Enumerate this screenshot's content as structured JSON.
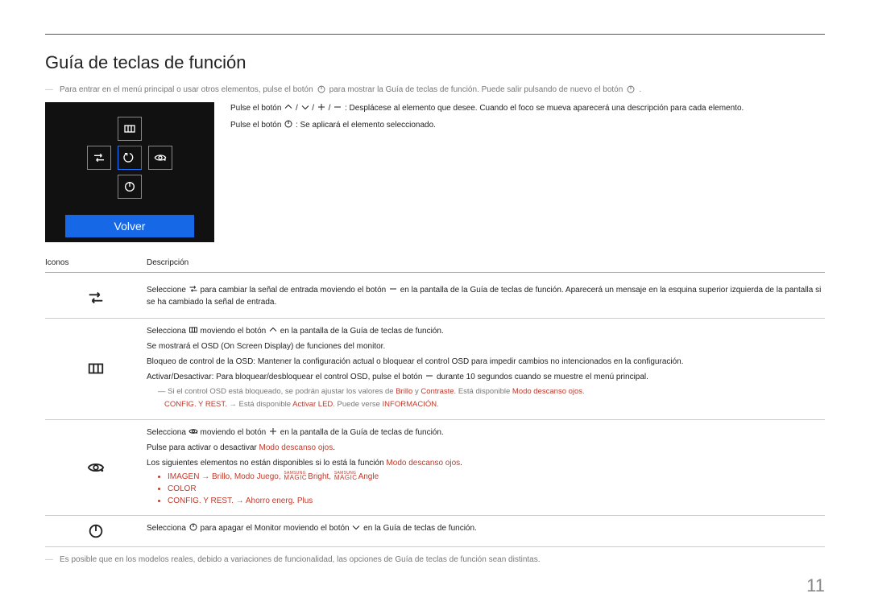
{
  "title": "Guía de teclas de función",
  "intro_note_a": "Para entrar en el menú principal o usar otros elementos, pulse el botón",
  "intro_note_b": "para mostrar la Guía de teclas de función. Puede salir pulsando de nuevo el botón",
  "osd_return": "Volver",
  "side_line1_a": "Pulse el botón",
  "side_line1_b": ": Desplácese al elemento que desee. Cuando el foco se mueva aparecerá una descripción para cada elemento.",
  "side_line2_a": "Pulse el botón",
  "side_line2_b": ": Se aplicará el elemento seleccionado.",
  "table": {
    "header_icon": "Iconos",
    "header_desc": "Descripción",
    "row1_a": "Seleccione",
    "row1_b": "para cambiar la señal de entrada moviendo el botón",
    "row1_c": "en la pantalla de la Guía de teclas de función. Aparecerá un mensaje en la esquina superior izquierda de la pantalla si se ha cambiado la señal de entrada.",
    "row2_a": "Selecciona",
    "row2_b": "moviendo el botón",
    "row2_c": "en la pantalla de la Guía de teclas de función.",
    "row2_d": "Se mostrará el OSD (On Screen Display) de funciones del monitor.",
    "row2_e": "Bloqueo de control de la OSD: Mantener la configuración actual o bloquear el control OSD para impedir cambios no intencionados en la configuración.",
    "row2_f": "Activar/Desactivar: Para bloquear/desbloquear el control OSD, pulse el botón",
    "row2_g": "durante 10 segundos cuando se muestre el menú principal.",
    "row2_note_a": "Si el control OSD está bloqueado, se podrán ajustar los valores de",
    "row2_note_brillo": "Brillo",
    "row2_note_y": " y ",
    "row2_note_contraste": "Contraste",
    "row2_note_mid": ". Está disponible ",
    "row2_note_modo": "Modo descanso ojos",
    "row2_note_period": ".",
    "row2_note2_a": "CONFIG. Y REST.",
    "row2_note2_b": " → Está disponible ",
    "row2_note2_c": "Activar LED",
    "row2_note2_d": ". Puede verse ",
    "row2_note2_e": "INFORMACIÓN",
    "row3_a": "Selecciona",
    "row3_b": "moviendo el botón",
    "row3_c": "en la pantalla de la Guía de teclas de función.",
    "row3_d_a": "Pulse para activar o desactivar ",
    "row3_d_b": "Modo descanso ojos",
    "row3_e_a": "Los siguientes elementos no están disponibles si lo está la función ",
    "row3_e_b": "Modo descanso ojos",
    "row3_bul1_a": "IMAGEN",
    "row3_bul1_b": "Brillo",
    "row3_bul1_c": "Modo Juego",
    "row3_bul1_bright": "Bright",
    "row3_bul1_angle": "Angle",
    "row3_bul2": "COLOR",
    "row3_bul3_a": "CONFIG. Y REST.",
    "row3_bul3_b": "Ahorro energ. Plus",
    "row4_a": "Selecciona",
    "row4_b": "para apagar el Monitor moviendo el botón",
    "row4_c": "en la Guía de teclas de función."
  },
  "foot_note": "Es posible que en los modelos reales, debido a variaciones de funcionalidad, las opciones de Guía de teclas de función sean distintas.",
  "page_number": "11"
}
